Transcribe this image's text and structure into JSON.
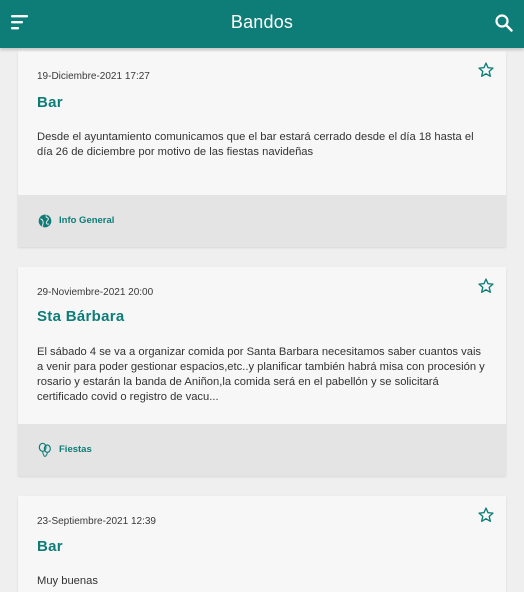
{
  "app": {
    "title": "Bandos",
    "colors": {
      "primary": "#0e7d78",
      "card": "#f7f7f7",
      "footer": "#e4e4e4",
      "background": "#efefef"
    }
  },
  "header": {
    "menu_icon": "menu-icon",
    "search_icon": "search-icon"
  },
  "bandos": [
    {
      "date": "19-Diciembre-2021 17:27",
      "title": "Bar",
      "body": "Desde el ayuntamiento comunicamos que el bar estará cerrado desde el día 18 hasta el día 26 de diciembre por motivo de las fiestas navideñas",
      "category": "Info General",
      "category_icon": "globe-icon"
    },
    {
      "date": "29-Noviembre-2021 20:00",
      "title": "Sta Bárbara",
      "body": "El sábado 4 se va a organizar comida por Santa Barbara necesitamos saber cuantos vais a venir para poder gestionar espacios,etc..y planificar también habrá misa con procesión y rosario y estarán la banda de Aniñon,la comida será en el pabellón y se solicitará certificado covid o registro de vacu...",
      "category": "Fiestas",
      "category_icon": "balloons-icon"
    },
    {
      "date": "23-Septiembre-2021 12:39",
      "title": "Bar",
      "body": "Muy buenas",
      "category": "",
      "category_icon": ""
    }
  ]
}
